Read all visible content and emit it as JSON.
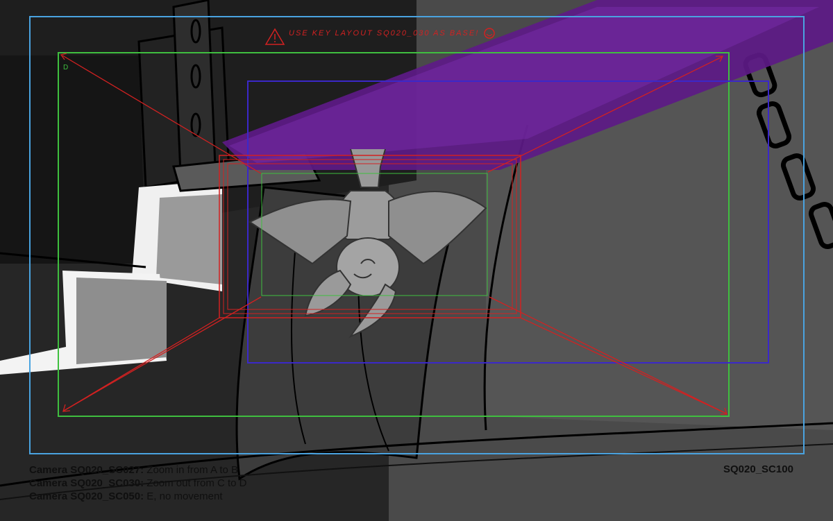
{
  "colors": {
    "frame_blue": "#4aa3e0",
    "frame_green": "#3fbf3f",
    "frame_indigo": "#3b28c9",
    "frame_red": "#d22121",
    "beam_purple": "#5d1a87"
  },
  "annotation": {
    "warning_text": "USE KEY LAYOUT SQ020_030 AS BASE!",
    "warning_icon": "warning-triangle-icon",
    "smiley_icon": "smiley-icon",
    "frame_label_d": "D"
  },
  "camera_notes": [
    {
      "camera": "Camera SQ020_SC027:",
      "action": "Zoom in from A to B"
    },
    {
      "camera": "Camera SQ020_SC030:",
      "action": "Zoom out from C to D"
    },
    {
      "camera": "Camera SQ020_SC050:",
      "action": "E, no movement"
    }
  ],
  "shot_id": "SQ020_SC100"
}
